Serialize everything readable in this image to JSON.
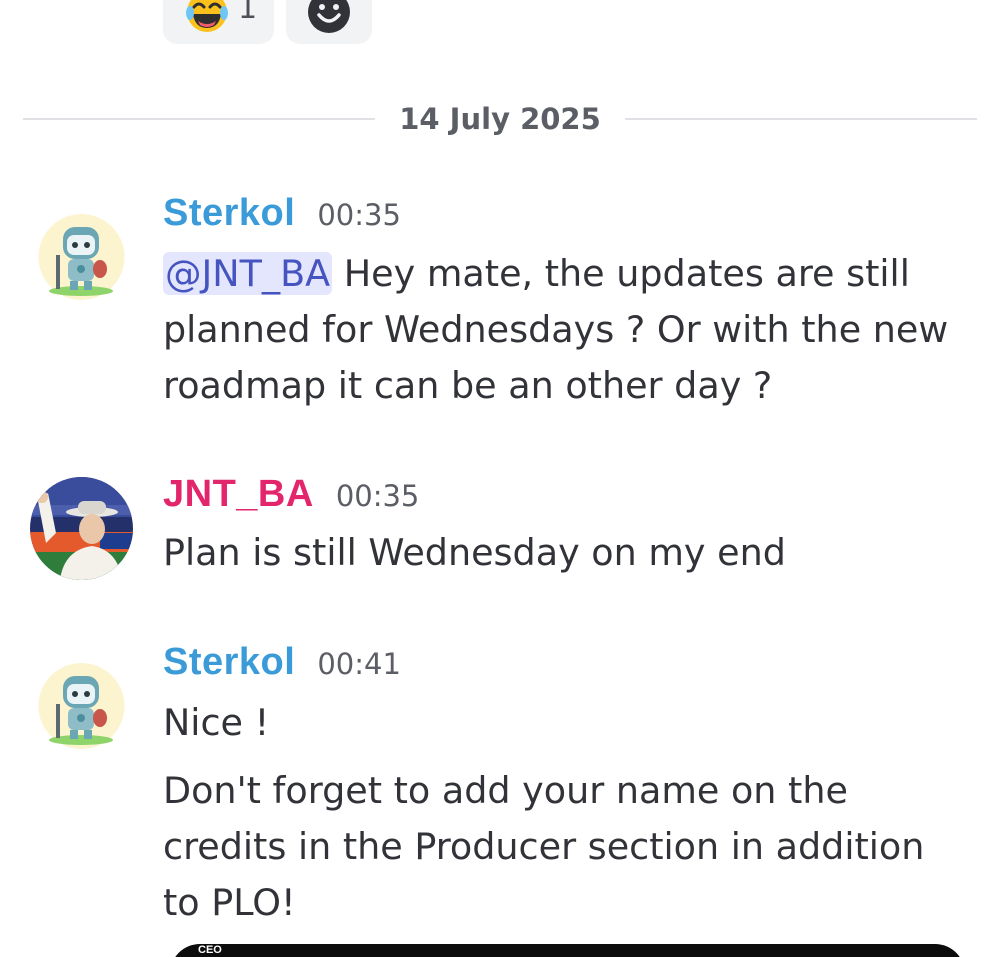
{
  "reactions": {
    "laugh": {
      "emoji": "face-with-tears-of-joy",
      "count": "1"
    },
    "add_reaction": {
      "icon": "add-reaction-icon"
    }
  },
  "divider": {
    "date": "14 July 2025"
  },
  "messages": [
    {
      "author": "Sterkol",
      "author_color": "#3a9bd8",
      "time": "00:35",
      "mention": "@JNT_BA",
      "text": " Hey mate, the updates are still planned for Wednesdays ? Or with the new roadmap it can be an other day ?"
    },
    {
      "author": "JNT_BA",
      "author_color": "#e3266c",
      "time": "00:35",
      "text": "Plan is still Wednesday on my end"
    },
    {
      "author": "Sterkol",
      "author_color": "#3a9bd8",
      "time": "00:41",
      "paragraphs": [
        "Nice !",
        "Don't forget to add your name on the credits in the Producer section in addition to PLO!"
      ]
    }
  ],
  "embed": {
    "label": "CEO"
  }
}
